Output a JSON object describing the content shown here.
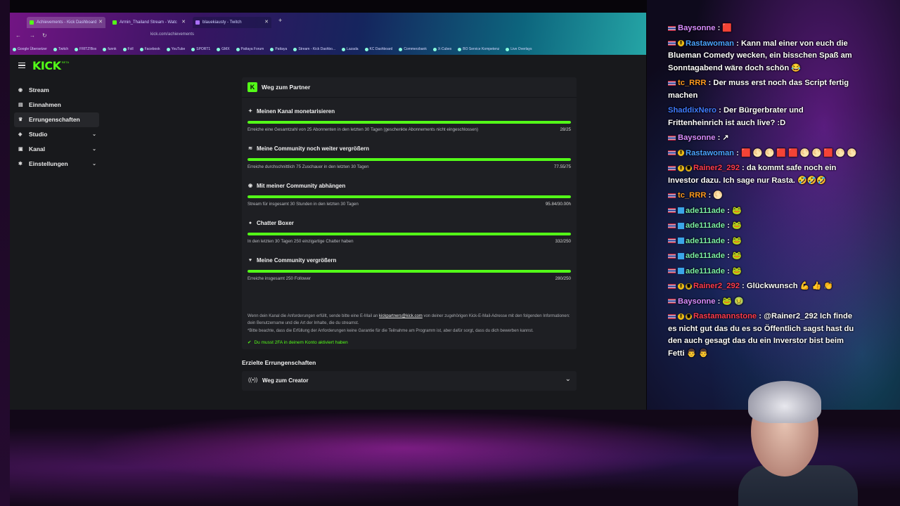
{
  "browser": {
    "tabs": [
      {
        "label": "Achievements - Kick Dashboard"
      },
      {
        "label": "Armin_Thailand Stream - Watc"
      },
      {
        "label": "blauekiausty - Twitch"
      }
    ],
    "url": "kick.com/achievements",
    "bookmarks": [
      "Google Übersetzer",
      "Twitch",
      "FRITZ!Box",
      "funnk",
      "Foll",
      "Facebook",
      "YouTube",
      "SPORT1",
      "GMX",
      "Pattaya Forum",
      "Pattaya",
      "Stream - Kick Dashbo...",
      "Lazada",
      "KC Dashboard",
      "Commerzbank",
      "X-Cubes",
      "BO Service Kompetenz",
      "Live Overlays"
    ]
  },
  "sidebar": {
    "items": [
      {
        "label": "Stream",
        "icon": "broadcast-icon",
        "glyph": "◉",
        "has_chevron": false
      },
      {
        "label": "Einnahmen",
        "icon": "money-icon",
        "glyph": "▤",
        "has_chevron": false
      },
      {
        "label": "Errungenschaften",
        "icon": "trophy-icon",
        "glyph": "♛",
        "has_chevron": false
      },
      {
        "label": "Studio",
        "icon": "studio-icon",
        "glyph": "◈",
        "has_chevron": true
      },
      {
        "label": "Kanal",
        "icon": "channel-icon",
        "glyph": "▣",
        "has_chevron": true
      },
      {
        "label": "Einstellungen",
        "icon": "gear-icon",
        "glyph": "✱",
        "has_chevron": true
      }
    ]
  },
  "partner_card": {
    "logo_letter": "K",
    "title": "Weg zum Partner",
    "goals": [
      {
        "icon": "sparkle-icon",
        "glyph": "✦",
        "title": "Meinen Kanal monetarisieren",
        "desc": "Erreiche eine Gesamtzahl von 25 Abonnenten in den letzten 30 Tagen (geschenkte Abonnements nicht eingeschlossen)",
        "value": "28/25",
        "progress": 1.0
      },
      {
        "icon": "community-icon",
        "glyph": "≋",
        "title": "Meine Community noch weiter vergrößern",
        "desc": "Erreiche durchschnittlich 75 Zuschauer in den letzten 30 Tagen",
        "value": "77.55/75",
        "progress": 1.0
      },
      {
        "icon": "broadcast-icon",
        "glyph": "◉",
        "title": "Mit meiner Community abhängen",
        "desc": "Stream für insgesamt 30 Stunden in den letzten 30 Tagen",
        "value": "95.84/30.00h",
        "progress": 1.0
      },
      {
        "icon": "chat-icon",
        "glyph": "●",
        "title": "Chatter Boxer",
        "desc": "In den letzten 30 Tagen 250 einzigartige Chatter haben",
        "value": "332/250",
        "progress": 1.0
      },
      {
        "icon": "heart-icon",
        "glyph": "♥",
        "title": "Meine Community vergrößern",
        "desc": "Erreiche insgesamt 250 Follower",
        "value": "280/250",
        "progress": 1.0
      }
    ],
    "info_pre": "Wenn dein Kanal die Anforderungen erfüllt, sende bitte eine E-Mail an ",
    "info_email": "kickpartners@kick.com",
    "info_post": " von deiner zugehörigen Kick-E-Mail-Adresse mit den folgenden Informationen: dein Benutzername und die Art der Inhalte, die du streamst.",
    "info_note": "*Bitte beachte, dass die Erfüllung der Anforderungen keine Garantie für die Teilnahme am Programm ist, aber dafür sorgt, dass du dich bewerben kannst.",
    "twofa": "Du musst 2FA in deinem Konto aktiviert haben"
  },
  "achieved": {
    "title": "Erzielte Errungenschaften",
    "creator_label": "Weg zum Creator"
  },
  "chat": [
    {
      "flag": true,
      "badges": [],
      "user": "Baysonne",
      "user_color": "#d98cff",
      "text": "",
      "emotes": "🟥"
    },
    {
      "flag": true,
      "badges": [
        "gold"
      ],
      "user": "Rastawoman",
      "user_color": "#4aa3ff",
      "text": "Kann mal einer von euch die Blueman Comedy wecken, ein bisschen Spaß am Sonntagabend wäre doch schön",
      "emotes": "😂"
    },
    {
      "flag": true,
      "badges": [],
      "user": "tc_RRR",
      "user_color": "#ff9a1f",
      "text": "Der muss erst noch das Script fertig machen",
      "emotes": ""
    },
    {
      "flag": false,
      "badges": [],
      "user": "ShaddixNero",
      "user_color": "#3f7bff",
      "text": "Der Bürgerbrater und Frittenheinrich ist auch live? :D",
      "emotes": ""
    },
    {
      "flag": true,
      "badges": [],
      "user": "Baysonne",
      "user_color": "#d98cff",
      "text": "",
      "emotes": "↗"
    },
    {
      "flag": true,
      "badges": [
        "gold"
      ],
      "user": "Rastawoman",
      "user_color": "#4aa3ff",
      "text": "",
      "emotes": "🟥 🌕 🌕 🟥 🟥 🌕 🌕 🟥 🌕 🌕"
    },
    {
      "flag": true,
      "badges": [
        "gold",
        "crown"
      ],
      "user": "Rainer2_292",
      "user_color": "#ff3b4e",
      "text": "da kommt safe noch ein Investor dazu. Ich sage nur Rasta.",
      "emotes": "🤣🤣🤣"
    },
    {
      "flag": true,
      "badges": [],
      "user": "tc_RRR",
      "user_color": "#ff9a1f",
      "text": "",
      "emotes": "🌕"
    },
    {
      "flag": true,
      "badges": [
        "blue"
      ],
      "user": "ade111ade",
      "user_color": "#7cf0a6",
      "text": "",
      "emotes": "🐸"
    },
    {
      "flag": true,
      "badges": [
        "blue"
      ],
      "user": "ade111ade",
      "user_color": "#7cf0a6",
      "text": "",
      "emotes": "🐸"
    },
    {
      "flag": true,
      "badges": [
        "blue"
      ],
      "user": "ade111ade",
      "user_color": "#7cf0a6",
      "text": "",
      "emotes": "🐸"
    },
    {
      "flag": true,
      "badges": [
        "blue"
      ],
      "user": "ade111ade",
      "user_color": "#7cf0a6",
      "text": "",
      "emotes": "🐸"
    },
    {
      "flag": true,
      "badges": [
        "blue"
      ],
      "user": "ade111ade",
      "user_color": "#7cf0a6",
      "text": "",
      "emotes": "🐸"
    },
    {
      "flag": true,
      "badges": [
        "gold",
        "crown"
      ],
      "user": "Rainer2_292",
      "user_color": "#ff3b4e",
      "text": "Glückwunsch",
      "emotes": "💪 👍 👏"
    },
    {
      "flag": true,
      "badges": [],
      "user": "Baysonne",
      "user_color": "#d98cff",
      "text": "",
      "emotes": "🐸 🤢"
    },
    {
      "flag": true,
      "badges": [
        "gold",
        "crown"
      ],
      "user": "Rastamannstone",
      "user_color": "#ff3b4e",
      "text": "@Rainer2_292 Ich finde es nicht gut das du es so Öffentlich sagst hast du den auch gesagt das du ein Inverstor bist beim Fetti",
      "emotes": "👨 👨"
    }
  ],
  "colors": {
    "accent": "#53fc18",
    "page_bg": "#18191c",
    "card_bg": "#1e1f23"
  }
}
